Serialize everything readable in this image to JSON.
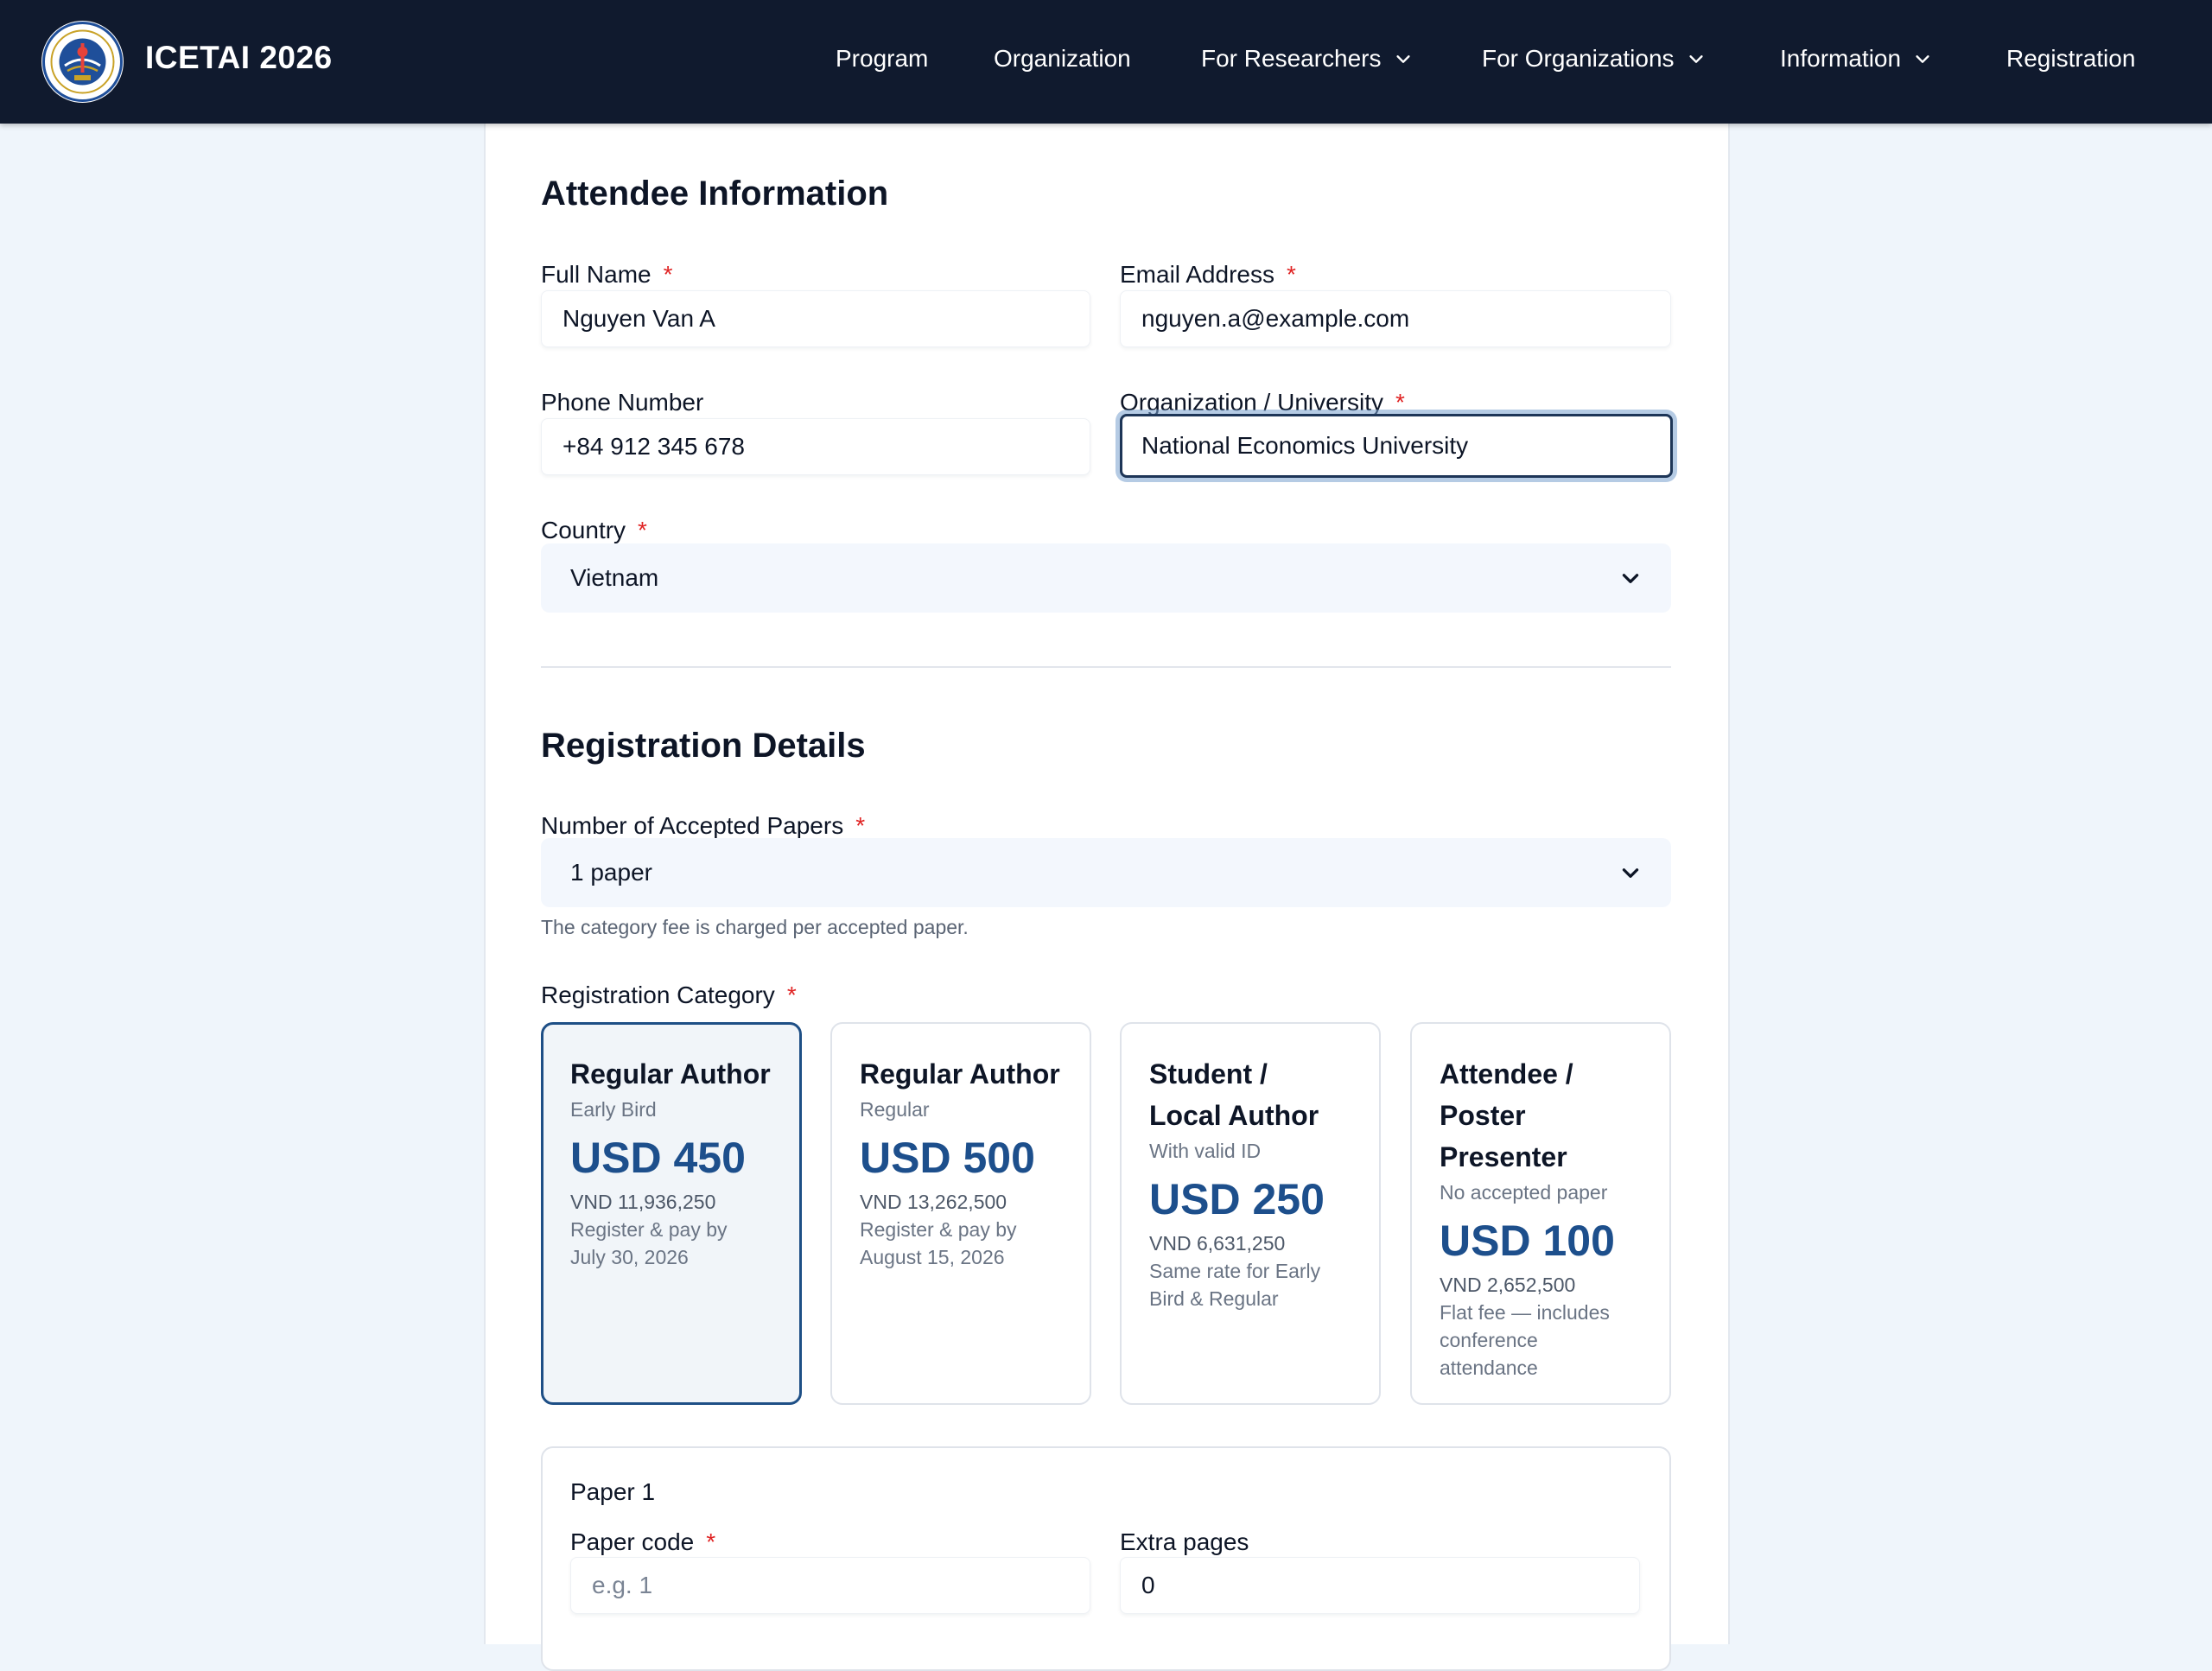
{
  "header": {
    "brand": "ICETAI 2026",
    "nav": [
      {
        "label": "Program"
      },
      {
        "label": "Organization"
      },
      {
        "label": "For Researchers"
      },
      {
        "label": "For Organizations"
      },
      {
        "label": "Information"
      },
      {
        "label": "Registration"
      }
    ]
  },
  "attendee": {
    "heading": "Attendee Information",
    "full_name": {
      "label": "Full Name",
      "required": "*",
      "value": "Nguyen Van A"
    },
    "email": {
      "label": "Email Address",
      "required": "*",
      "value": "nguyen.a@example.com"
    },
    "phone": {
      "label": "Phone Number",
      "value": "+84 912 345 678"
    },
    "organization": {
      "label": "Organization / University",
      "required": "*",
      "value": "National Economics University"
    },
    "country": {
      "label": "Country",
      "required": "*",
      "value": "Vietnam"
    }
  },
  "registration": {
    "heading": "Registration Details",
    "papers": {
      "label": "Number of Accepted Papers",
      "required": "*",
      "value": "1 paper",
      "help": "The category fee is charged per accepted paper."
    },
    "category": {
      "label": "Registration Category",
      "required": "*",
      "options": [
        {
          "title_lines": [
            "Regular Author"
          ],
          "sub": "Early Bird",
          "price": "USD 450",
          "vnd": "VND 11,936,250",
          "note_lines": [
            "Register & pay by",
            "July 30, 2026"
          ],
          "selected": true
        },
        {
          "title_lines": [
            "Regular Author"
          ],
          "sub": "Regular",
          "price": "USD 500",
          "vnd": "VND 13,262,500",
          "note_lines": [
            "Register & pay by",
            "August 15, 2026"
          ],
          "selected": false
        },
        {
          "title_lines": [
            "Student /",
            "Local Author"
          ],
          "sub": "With valid ID",
          "price": "USD 250",
          "vnd": "VND 6,631,250",
          "note_lines": [
            "Same rate for Early",
            "Bird & Regular"
          ],
          "selected": false
        },
        {
          "title_lines": [
            "Attendee /",
            "Poster",
            "Presenter"
          ],
          "sub": "No accepted paper",
          "price": "USD 100",
          "vnd": "VND 2,652,500",
          "note_lines": [
            "Flat fee — includes",
            "conference",
            "attendance"
          ],
          "selected": false
        }
      ]
    },
    "paper1": {
      "title": "Paper 1",
      "code": {
        "label": "Paper code",
        "required": "*",
        "placeholder": "e.g. 1"
      },
      "extra_pages": {
        "label": "Extra pages",
        "value": "0"
      }
    }
  },
  "colors": {
    "header_bg": "#101a2e",
    "accent": "#1d4f8c",
    "required": "#e02424",
    "page_bg": "#eff5fb"
  }
}
